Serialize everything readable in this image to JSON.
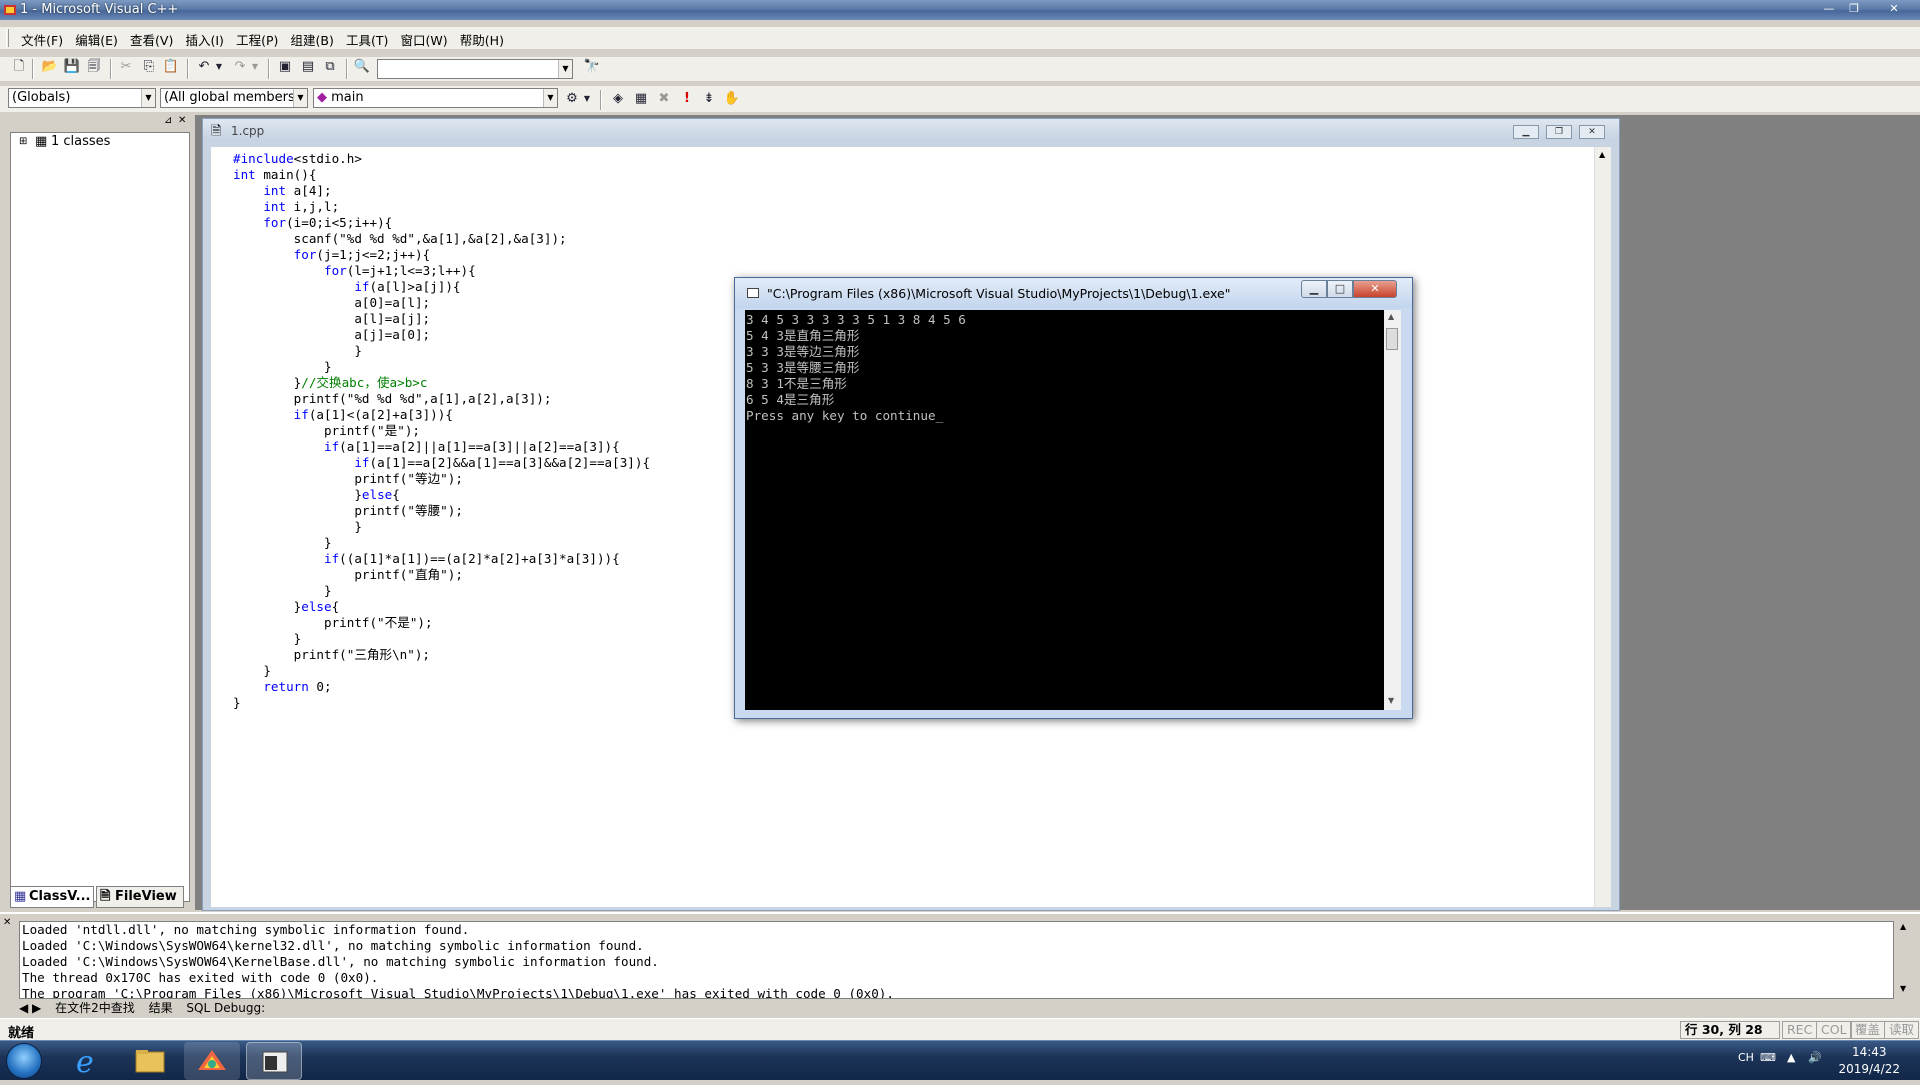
{
  "window": {
    "title": "1 - Microsoft Visual C++"
  },
  "menu": [
    "文件(F)",
    "编辑(E)",
    "查看(V)",
    "插入(I)",
    "工程(P)",
    "组建(B)",
    "工具(T)",
    "窗口(W)",
    "帮助(H)"
  ],
  "toolbar2": {
    "scope": "(Globals)",
    "members": "(All global members",
    "function": "main"
  },
  "workspace": {
    "tree_root": "1 classes",
    "tabs": [
      "ClassV...",
      "FileView"
    ]
  },
  "document": {
    "title": "1.cpp",
    "code": [
      "#include<stdio.h>",
      "int main(){",
      "    int a[4];",
      "    int i,j,l;",
      "    for(i=0;i<5;i++){",
      "        scanf(\"%d %d %d\",&a[1],&a[2],&a[3]);",
      "        for(j=1;j<=2;j++){",
      "            for(l=j+1;l<=3;l++){",
      "                if(a[l]>a[j]){",
      "                a[0]=a[l];",
      "                a[l]=a[j];",
      "                a[j]=a[0];",
      "                }",
      "            }",
      "        }//交换abc，使a>b>c",
      "        printf(\"%d %d %d\",a[1],a[2],a[3]);",
      "        if(a[1]<(a[2]+a[3])){",
      "            printf(\"是\");",
      "            if(a[1]==a[2]||a[1]==a[3]||a[2]==a[3]){",
      "                if(a[1]==a[2]&&a[1]==a[3]&&a[2]==a[3]){",
      "                printf(\"等边\");",
      "                }else{",
      "                printf(\"等腰\");",
      "                }",
      "            }",
      "            if((a[1]*a[1])==(a[2]*a[2]+a[3]*a[3])){",
      "                printf(\"直角\");",
      "            }",
      "        }else{",
      "            printf(\"不是\");",
      "        }",
      "        printf(\"三角形\\n\");",
      "    }",
      "    return 0;",
      "}"
    ]
  },
  "console": {
    "title": "\"C:\\Program Files (x86)\\Microsoft Visual Studio\\MyProjects\\1\\Debug\\1.exe\"",
    "lines": [
      "3 4 5 3 3 3 3 3 5 1 3 8 4 5 6",
      "5 4 3是直角三角形",
      "3 3 3是等边三角形",
      "5 3 3是等腰三角形",
      "8 3 1不是三角形",
      "6 5 4是三角形",
      "Press any key to continue"
    ]
  },
  "output": {
    "lines": [
      "Loaded 'ntdll.dll', no matching symbolic information found.",
      "Loaded 'C:\\Windows\\SysWOW64\\kernel32.dll', no matching symbolic information found.",
      "Loaded 'C:\\Windows\\SysWOW64\\KernelBase.dll', no matching symbolic information found.",
      "The thread 0x170C has exited with code 0 (0x0).",
      "The program 'C:\\Program Files (x86)\\Microsoft Visual Studio\\MyProjects\\1\\Debug\\1.exe' has exited with code 0 (0x0)."
    ],
    "tabs": [
      "在文件2中查找",
      "结果",
      "SQL Debugg:"
    ]
  },
  "status": {
    "ready": "就绪",
    "position": "行 30, 列 28",
    "rec": "REC",
    "col": "COL",
    "ovr": "覆盖",
    "read": "读取"
  },
  "taskbar": {
    "lang": "CH",
    "time": "14:43",
    "date": "2019/4/22"
  }
}
